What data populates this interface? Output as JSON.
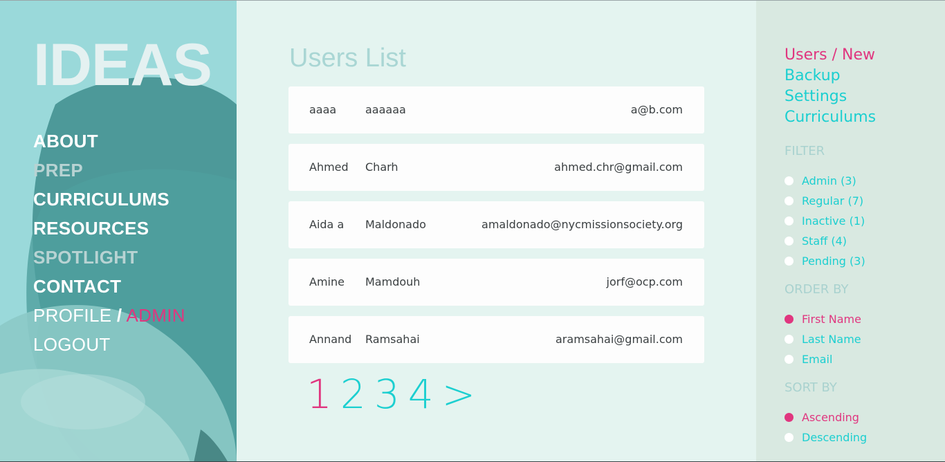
{
  "sidebar": {
    "logo": "IDEAS",
    "nav": {
      "about": "ABOUT",
      "prep": "PREP",
      "curriculums": "CURRICULUMS",
      "resources": "RESOURCES",
      "spotlight": "SPOTLIGHT",
      "contact": "CONTACT",
      "profile": "PROFILE",
      "slash": "/",
      "admin": "ADMIN",
      "logout": "LOGOUT"
    }
  },
  "main": {
    "title": "Users List",
    "users": [
      {
        "first": "aaaa",
        "last": "aaaaaa",
        "email": "a@b.com"
      },
      {
        "first": "Ahmed",
        "last": "Charh",
        "email": "ahmed.chr@gmail.com"
      },
      {
        "first": "Aida a",
        "last": "Maldonado",
        "email": "amaldonado@nycmissionsociety.org"
      },
      {
        "first": "Amine",
        "last": "Mamdouh",
        "email": "jorf@ocp.com"
      },
      {
        "first": "Annand",
        "last": "Ramsahai",
        "email": "aramsahai@gmail.com"
      }
    ],
    "pagination": {
      "pages": [
        "1",
        "2",
        "3",
        "4"
      ],
      "next": ">",
      "active_page": "1"
    }
  },
  "right": {
    "links": {
      "users_new": "Users / New",
      "backup": "Backup",
      "settings": "Settings",
      "curriculums": "Curriculums"
    },
    "filter": {
      "heading": "FILTER",
      "options": [
        "Admin (3)",
        "Regular (7)",
        "Inactive (1)",
        "Staff (4)",
        "Pending (3)"
      ]
    },
    "order_by": {
      "heading": "ORDER BY",
      "options": [
        "First Name",
        "Last Name",
        "Email"
      ],
      "selected": "First Name"
    },
    "sort_by": {
      "heading": "SORT BY",
      "options": [
        "Ascending",
        "Descending"
      ],
      "selected": "Ascending"
    }
  },
  "colors": {
    "accent_pink": "#e0367f",
    "accent_cyan": "#1ccfd0",
    "sidebar_bg": "#9ad9da",
    "center_bg": "#e4f4f0",
    "right_bg": "#d9e9e1"
  }
}
